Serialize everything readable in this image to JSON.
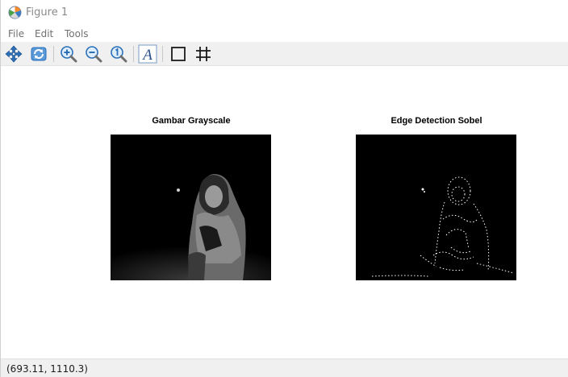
{
  "window": {
    "title": "Figure 1"
  },
  "menu": {
    "items": [
      "File",
      "Edit",
      "Tools"
    ]
  },
  "toolbar": {
    "tools": [
      {
        "icon": "pan-icon"
      },
      {
        "icon": "rotate-icon"
      },
      {
        "icon": "zoom-in-icon"
      },
      {
        "icon": "zoom-out-icon"
      },
      {
        "icon": "zoom-reset-icon"
      },
      {
        "icon": "text-insert-icon"
      },
      {
        "icon": "box-toggle-icon"
      },
      {
        "icon": "grid-toggle-icon"
      }
    ]
  },
  "figure": {
    "left_axes": {
      "title": "Gambar Grayscale"
    },
    "right_axes": {
      "title": "Edge Detection Sobel"
    }
  },
  "status": {
    "coords": "(693.11, 1110.3)"
  },
  "colors": {
    "toolbar_bg": "#f0f0f0",
    "icon_blue": "#2a6fb8",
    "status_bg": "#f0f0f0"
  }
}
